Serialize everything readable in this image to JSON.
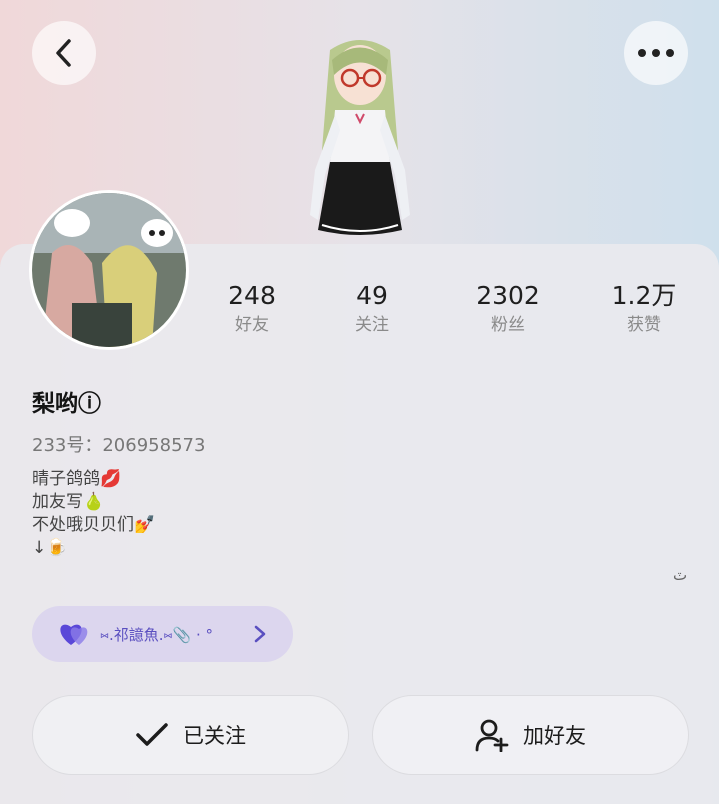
{
  "header": {
    "back_icon": "chevron-left-icon",
    "more_icon": "ellipsis-icon"
  },
  "profile": {
    "name": "梨哟ⓘ",
    "uid": "233号：206958573",
    "bio": [
      "晴子鸽鸽💋",
      "加友写🍐",
      "不处哦贝贝们💅",
      "↓🍺"
    ],
    "corner_mark": "ٽ"
  },
  "stats": [
    {
      "value": "248",
      "label": "好友"
    },
    {
      "value": "49",
      "label": "关注"
    },
    {
      "value": "2302",
      "label": "粉丝"
    },
    {
      "value": "1.2万",
      "label": "获赞"
    }
  ],
  "tag": {
    "text": "⑅.祁譩魚.⑅📎 · °",
    "icon": "heart-icon",
    "accent": "#6b5cd6"
  },
  "actions": {
    "following_label": "已关注",
    "add_friend_label": "加好友"
  }
}
